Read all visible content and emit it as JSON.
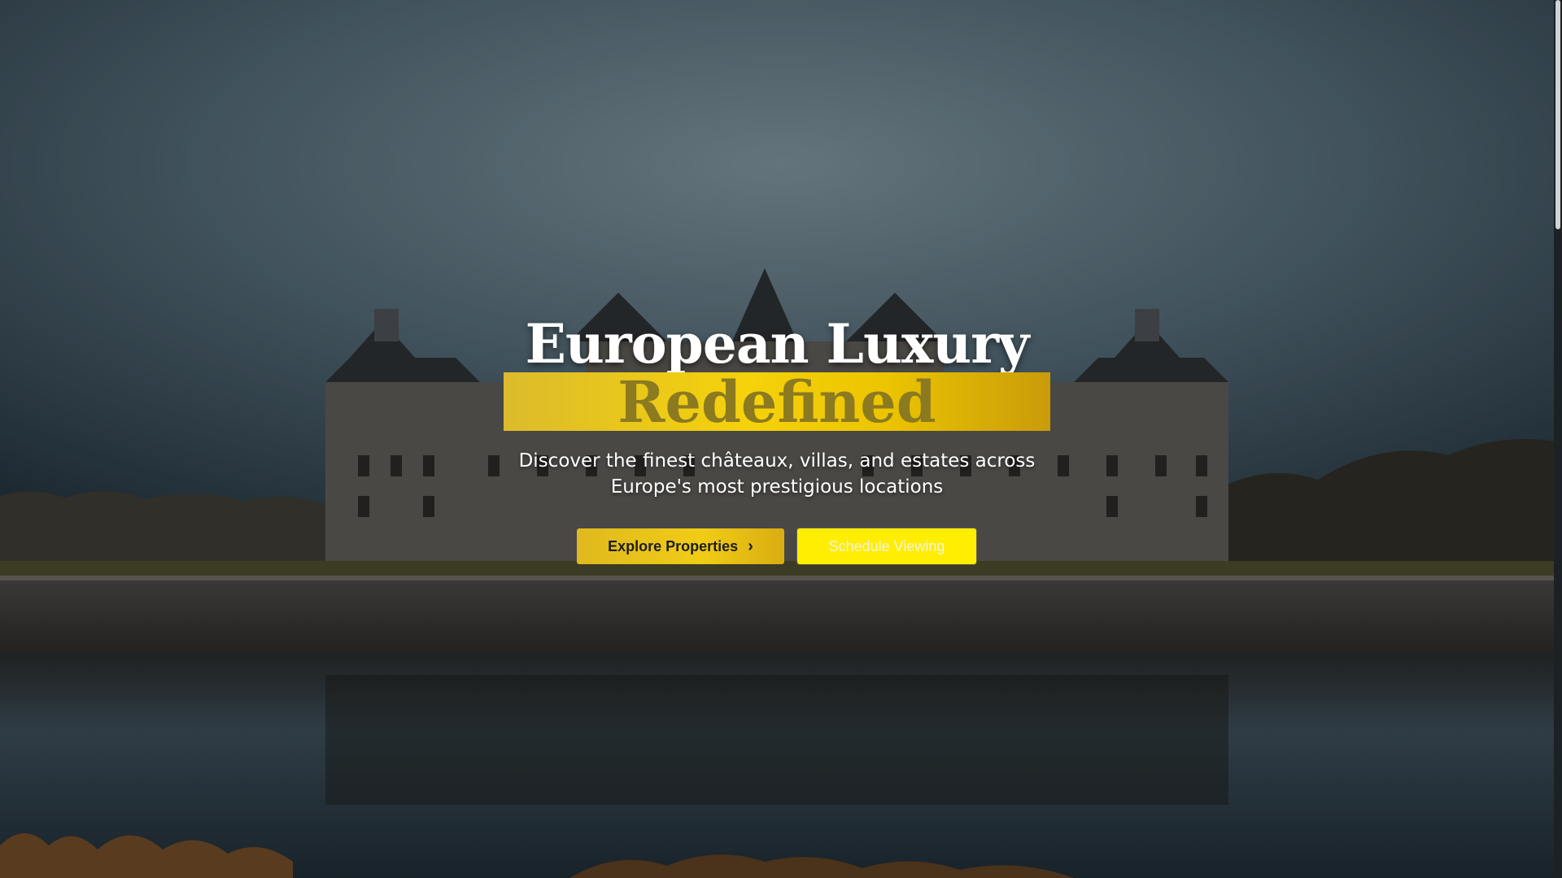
{
  "hero": {
    "background_description_icon": "chateau-photo",
    "title_line1": "European Luxury",
    "title_line2": "Redefined",
    "subtitle": "Discover the finest châteaux, villas, and estates across Europe's most prestigious locations",
    "primary_button_label": "Explore Properties",
    "primary_button_icon": "chevron-right-icon",
    "secondary_button_label": "Schedule Viewing"
  },
  "colors": {
    "accent_gold": "#f1cc16",
    "secondary_yellow": "#ffee00",
    "title_white": "#ffffff"
  }
}
